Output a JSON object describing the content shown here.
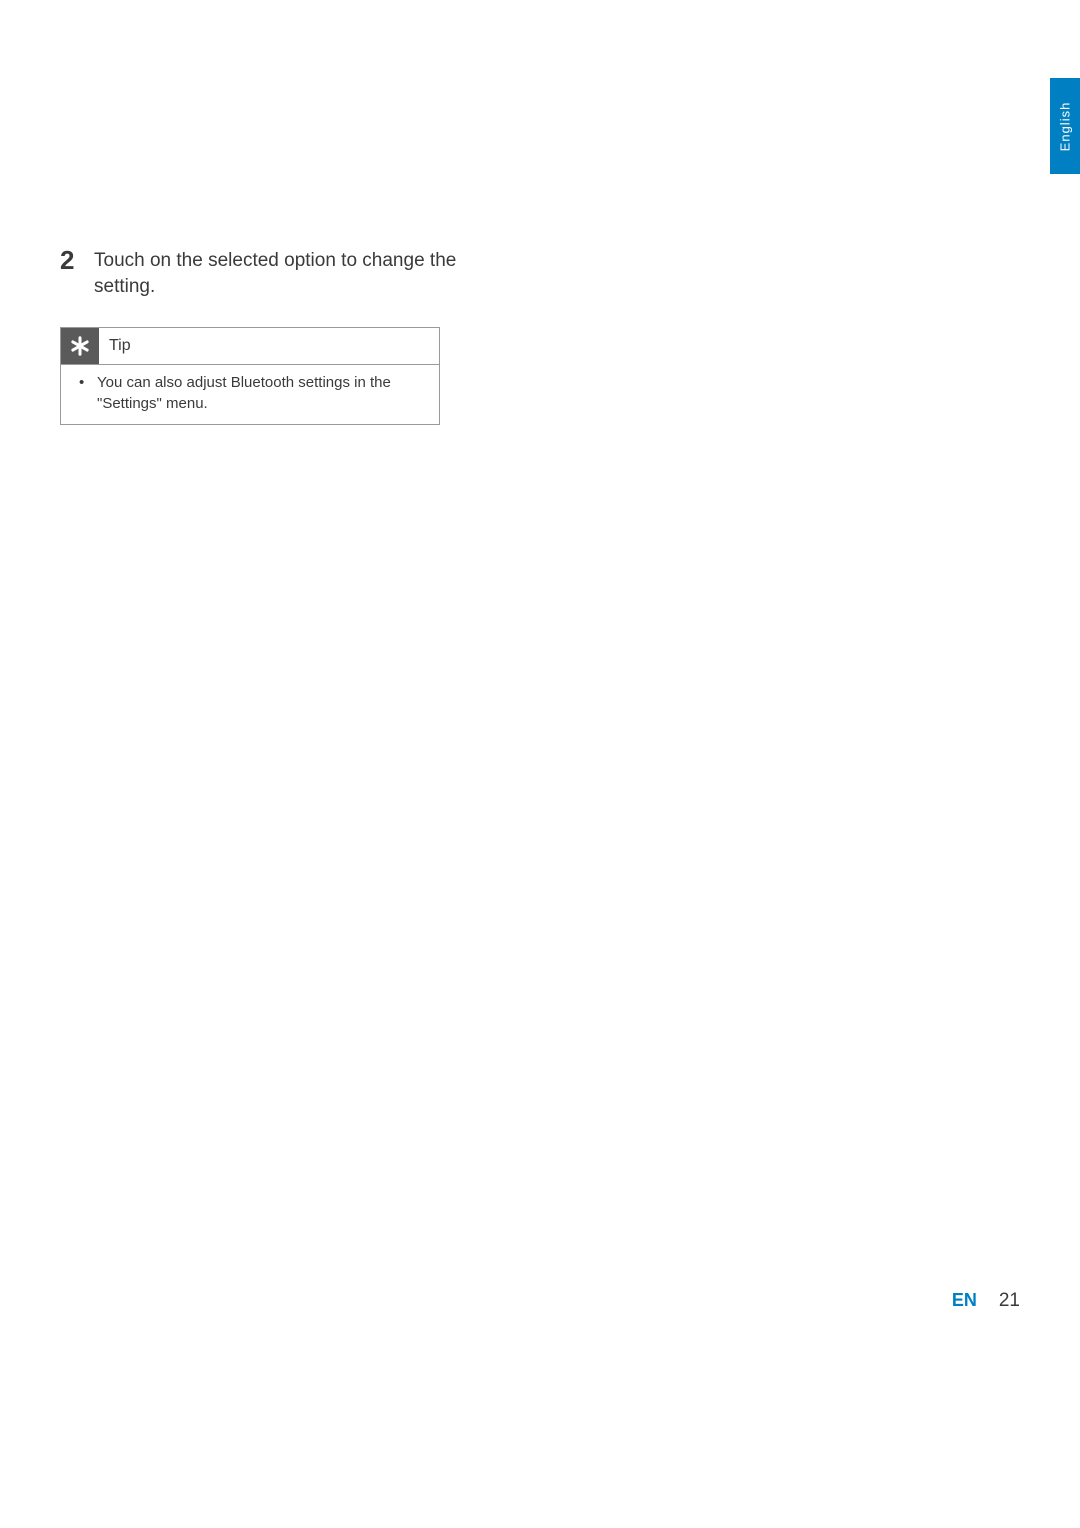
{
  "languageTab": "English",
  "step": {
    "number": "2",
    "text": "Touch on the selected option to change the setting."
  },
  "tip": {
    "label": "Tip",
    "items": [
      "You can also adjust Bluetooth settings in the \"Settings\" menu."
    ]
  },
  "footer": {
    "langCode": "EN",
    "pageNumber": "21"
  }
}
